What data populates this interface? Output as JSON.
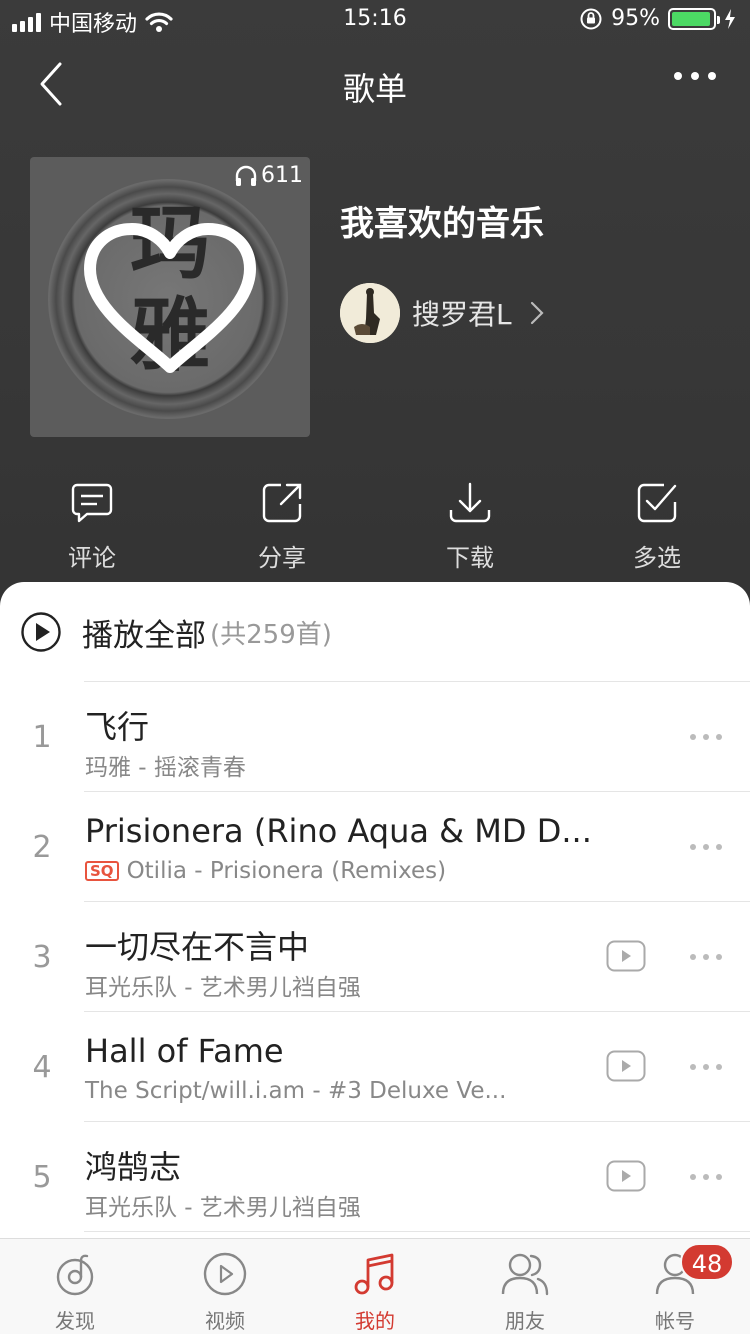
{
  "status_bar": {
    "carrier": "中国移动",
    "time": "15:16",
    "battery_percent": "95%",
    "battery_level": 0.95
  },
  "nav": {
    "title": "歌单"
  },
  "playlist": {
    "play_count": "611",
    "name": "我喜欢的音乐",
    "creator": "搜罗君L",
    "cover_text": "玛雅"
  },
  "actions": [
    {
      "label": "评论",
      "icon": "comment-icon"
    },
    {
      "label": "分享",
      "icon": "share-icon"
    },
    {
      "label": "下载",
      "icon": "download-icon"
    },
    {
      "label": "多选",
      "icon": "multi-select-icon"
    }
  ],
  "list": {
    "play_all_label": "播放全部",
    "total": "(共259首)",
    "songs": [
      {
        "index": "1",
        "title": "飞行",
        "subtitle": "玛雅 - 摇滚青春",
        "sq": false,
        "mv": false
      },
      {
        "index": "2",
        "title": "Prisionera (Rino Aqua & MD D...",
        "subtitle": "Otilia - Prisionera (Remixes)",
        "sq": true,
        "sq_label": "SQ",
        "mv": false
      },
      {
        "index": "3",
        "title": "一切尽在不言中",
        "subtitle": "耳光乐队 - 艺术男儿裆自强",
        "sq": false,
        "mv": true
      },
      {
        "index": "4",
        "title": "Hall of Fame",
        "subtitle": "The Script/will.i.am - #3 Deluxe Ve...",
        "sq": false,
        "mv": true
      },
      {
        "index": "5",
        "title": "鸿鹄志",
        "subtitle": "耳光乐队 - 艺术男儿裆自强",
        "sq": false,
        "mv": true
      }
    ]
  },
  "tabbar": {
    "tabs": [
      {
        "label": "发现",
        "icon": "discover-icon"
      },
      {
        "label": "视频",
        "icon": "video-icon"
      },
      {
        "label": "我的",
        "icon": "music-note-icon"
      },
      {
        "label": "朋友",
        "icon": "friends-icon"
      },
      {
        "label": "帐号",
        "icon": "account-icon"
      }
    ],
    "active": 2,
    "account_badge": "48"
  },
  "colors": {
    "accent": "#d33a31",
    "header_bg": "#3a3a3a",
    "battery": "#4cd964",
    "sq_badge": "#e8543e"
  }
}
